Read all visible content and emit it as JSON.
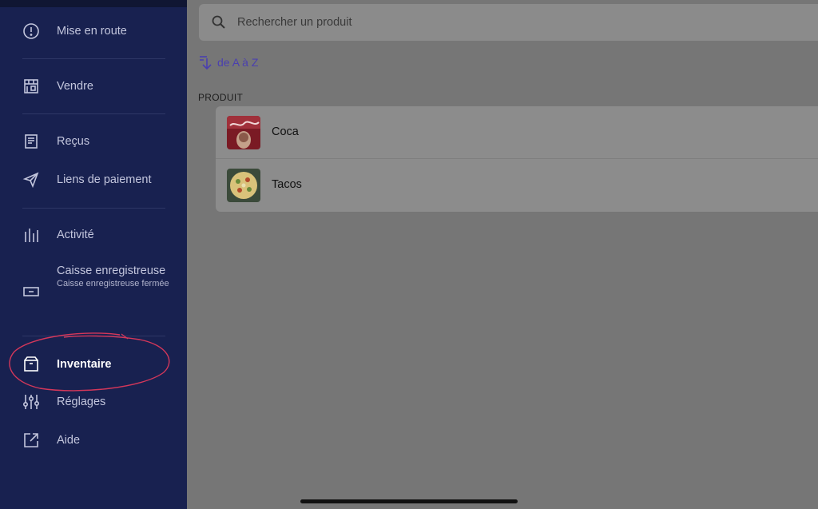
{
  "sidebar": {
    "items": [
      {
        "label": "Mise en route",
        "icon": "info-circle-icon"
      },
      {
        "label": "Vendre",
        "icon": "store-grid-icon"
      },
      {
        "label": "Reçus",
        "icon": "receipt-icon"
      },
      {
        "label": "Liens de paiement",
        "icon": "paper-plane-icon"
      },
      {
        "label": "Activité",
        "icon": "bar-chart-icon"
      },
      {
        "label": "Caisse enregistreuse",
        "sub": "Caisse enregistreuse fermée",
        "icon": "cash-register-icon"
      },
      {
        "label": "Inventaire",
        "icon": "box-icon",
        "active": true
      },
      {
        "label": "Réglages",
        "icon": "sliders-icon"
      },
      {
        "label": "Aide",
        "icon": "external-link-icon"
      }
    ]
  },
  "main": {
    "search": {
      "placeholder": "Rechercher un produit"
    },
    "sort": {
      "label": "de A à Z"
    },
    "column_header": "PRODUIT",
    "products": [
      {
        "name": "Coca"
      },
      {
        "name": "Tacos"
      }
    ]
  },
  "colors": {
    "sidebar_bg": "#182150",
    "accent": "#4a3fb0",
    "annotation": "#d4375a"
  }
}
